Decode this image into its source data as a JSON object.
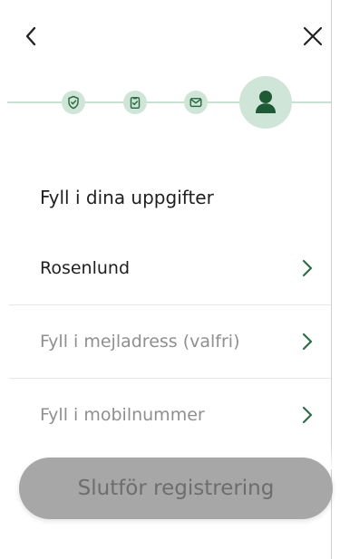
{
  "header": {
    "back_icon": "chevron-left-icon",
    "close_icon": "close-icon"
  },
  "stepper": {
    "steps": [
      {
        "icon": "shield-check-icon",
        "state": "completed"
      },
      {
        "icon": "clipboard-check-icon",
        "state": "completed"
      },
      {
        "icon": "envelope-icon",
        "state": "completed"
      },
      {
        "icon": "user-icon",
        "state": "active"
      }
    ],
    "accent_color": "#2f6d46",
    "light_color": "#cfe5d8"
  },
  "main": {
    "title": "Fyll i dina uppgifter",
    "items": [
      {
        "label": "Rosenlund",
        "state": "filled"
      },
      {
        "label": "Fyll i mejladress (valfri)",
        "state": "placeholder"
      },
      {
        "label": "Fyll i mobilnummer",
        "state": "placeholder"
      }
    ]
  },
  "cta": {
    "label": "Slutför registrering",
    "state": "disabled"
  }
}
